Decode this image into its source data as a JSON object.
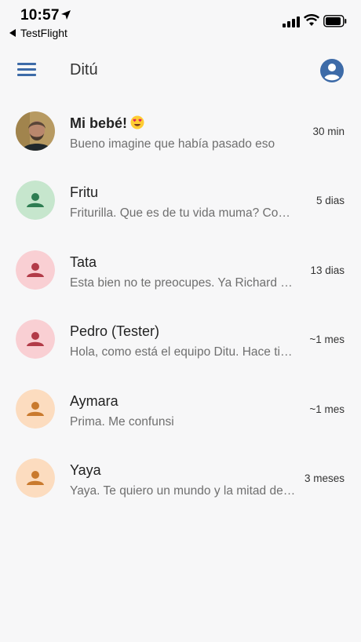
{
  "status_bar": {
    "time": "10:57",
    "back_label": "TestFlight"
  },
  "app_bar": {
    "title": "Ditú",
    "accent_color": "#3d6ba8"
  },
  "chats": [
    {
      "name": "Mi bebé!",
      "emoji": "heart-eyes-emoji",
      "preview": "Bueno  imagine que había pasado eso",
      "ago": "30 min",
      "avatar": "photo",
      "bold": true
    },
    {
      "name": "Fritu",
      "preview": "Friturilla. Que es de tu vida muma? Como estas?",
      "ago": "5 dias",
      "avatar_bg": "#c6e6cd",
      "avatar_fg": "#2e7d52"
    },
    {
      "name": "Tata",
      "preview": "Esta bien no te preocupes. Ya Richard me contó",
      "ago": "13 dias",
      "avatar_bg": "#f9cfd3",
      "avatar_fg": "#b23b48"
    },
    {
      "name": "Pedro (Tester)",
      "preview": "Hola, como está el equipo Ditu. Hace tiempo",
      "ago": "~1 mes",
      "avatar_bg": "#f9cfd3",
      "avatar_fg": "#b23b48"
    },
    {
      "name": "Aymara",
      "preview": "Prima. Me confunsi",
      "ago": "~1 mes",
      "avatar_bg": "#fcdcbf",
      "avatar_fg": "#c97a2e"
    },
    {
      "name": "Yaya",
      "preview": "Yaya. Te quiero un mundo y la mitad del otro",
      "ago": "3 meses",
      "avatar_bg": "#fcdcbf",
      "avatar_fg": "#c97a2e"
    }
  ]
}
